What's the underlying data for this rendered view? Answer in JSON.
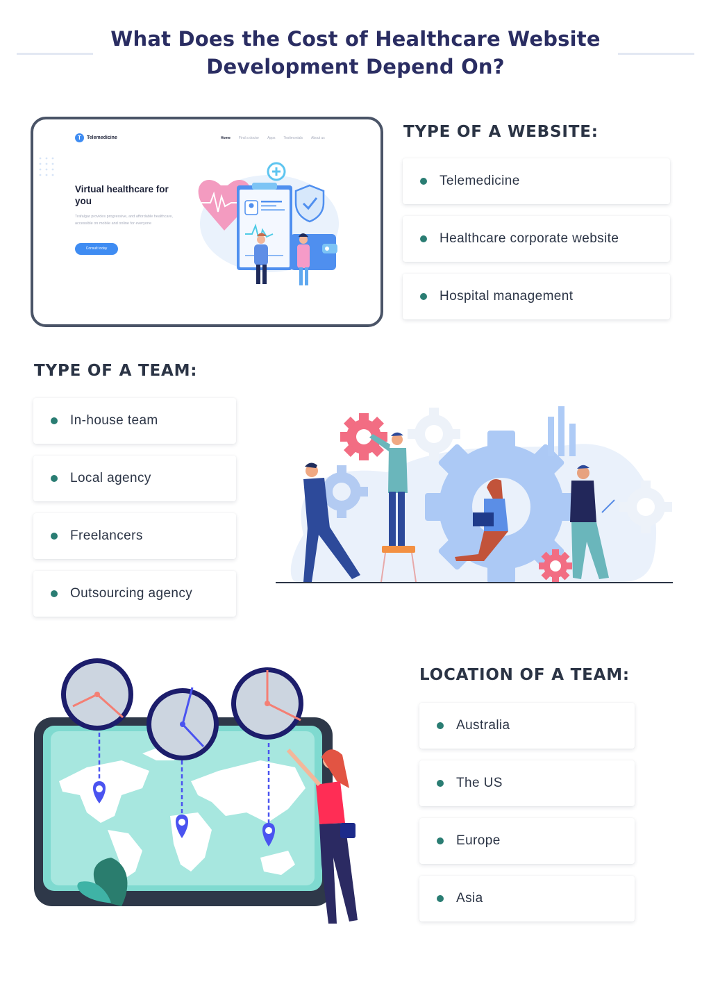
{
  "title": {
    "line1": "What Does the Cost of Healthcare Website",
    "line2": "Development Depend On?"
  },
  "colors": {
    "title": "#2a2d62",
    "heading": "#2b3445",
    "bullet": "#2a7d73",
    "mockup_border": "#4a5467",
    "accent_blue": "#3f8cf2"
  },
  "website_mockup": {
    "logo_letter": "T",
    "logo_text": "Telemedicine",
    "nav": [
      "Home",
      "Find a doctor",
      "Apps",
      "Testimonials",
      "About us"
    ],
    "hero_title": "Virtual healthcare for you",
    "hero_text": "Trafalgar provides progressive, and affordable healthcare, accessible on mobile and online for everyone",
    "cta_label": "Consult today"
  },
  "sections": {
    "website_type": {
      "heading": "TYPE OF A WEBSITE:",
      "items": [
        "Telemedicine",
        "Healthcare corporate website",
        "Hospital management"
      ]
    },
    "team_type": {
      "heading": "TYPE OF A TEAM:",
      "items": [
        "In-house team",
        "Local agency",
        "Freelancers",
        "Outsourcing agency"
      ]
    },
    "team_location": {
      "heading": "LOCATION OF A TEAM:",
      "items": [
        "Australia",
        "The US",
        "Europe",
        "Asia"
      ]
    }
  },
  "illustrations": {
    "website": "telemedicine-landing-page-mockup",
    "team": "people-assembling-gears",
    "location": "world-map-with-time-zone-clocks"
  }
}
